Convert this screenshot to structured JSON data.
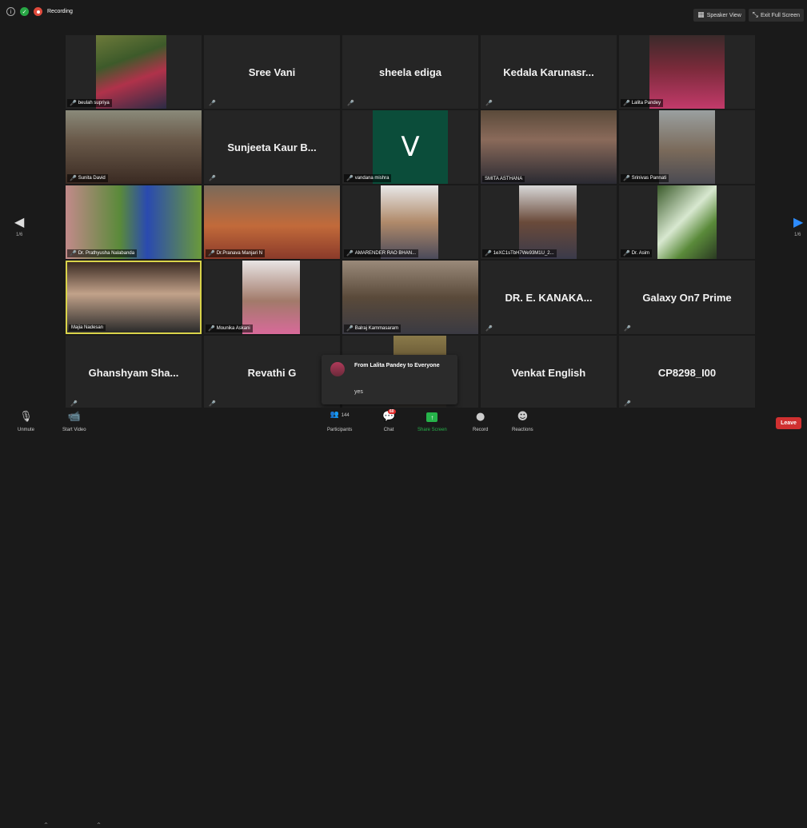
{
  "topbar": {
    "recording_label": "Recording",
    "speaker_view_label": "Speaker View",
    "exit_fullscreen_label": "Exit Full Screen"
  },
  "pagination": {
    "left": "1/6",
    "right": "1/6"
  },
  "tiles": [
    {
      "name": "beulah supriya",
      "display": "",
      "kind": "video"
    },
    {
      "name": "",
      "display": "Sree Vani",
      "kind": "name"
    },
    {
      "name": "",
      "display": "sheela ediga",
      "kind": "name"
    },
    {
      "name": "",
      "display": "Kedala  Karunasr...",
      "kind": "name"
    },
    {
      "name": "Lalita Pandey",
      "display": "",
      "kind": "video"
    },
    {
      "name": "Sunita David",
      "display": "",
      "kind": "video"
    },
    {
      "name": "",
      "display": "Sunjeeta Kaur B...",
      "kind": "name"
    },
    {
      "name": "vandana mishra",
      "display": "V",
      "kind": "avatar"
    },
    {
      "name": "SMITA ASTHANA",
      "display": "",
      "kind": "video"
    },
    {
      "name": "Srinivas Pannati",
      "display": "",
      "kind": "video"
    },
    {
      "name": "Dr. Prathyusha Nalabanda",
      "display": "",
      "kind": "video"
    },
    {
      "name": "Dr.Pranava Manjari N",
      "display": "",
      "kind": "video"
    },
    {
      "name": "AMARENDER RAO BHAN...",
      "display": "",
      "kind": "video"
    },
    {
      "name": "1eXC1sTbH7We93M1U_2...",
      "display": "",
      "kind": "video"
    },
    {
      "name": "Dr. Asim",
      "display": "",
      "kind": "video"
    },
    {
      "name": "Majia Nadesan",
      "display": "",
      "kind": "video"
    },
    {
      "name": "Mounika Askani",
      "display": "",
      "kind": "video"
    },
    {
      "name": "Balraj Kammasaram",
      "display": "",
      "kind": "video"
    },
    {
      "name": "",
      "display": "DR. E. KANAKA...",
      "kind": "name"
    },
    {
      "name": "",
      "display": "Galaxy On7 Prime",
      "kind": "name"
    },
    {
      "name": "",
      "display": "Ghanshyam  Sha...",
      "kind": "name"
    },
    {
      "name": "",
      "display": "Revathi G",
      "kind": "name"
    },
    {
      "name": "",
      "display": "",
      "kind": "video"
    },
    {
      "name": "",
      "display": "Venkat English",
      "kind": "name"
    },
    {
      "name": "",
      "display": "CP8298_I00",
      "kind": "name"
    }
  ],
  "chat": {
    "from": "From Lalita Pandey to Everyone",
    "message": "yes"
  },
  "toolbar": {
    "unmute": "Unmute",
    "start_video": "Start Video",
    "participants": "Participants",
    "participants_count": "144",
    "chat": "Chat",
    "chat_badge": "60",
    "share_screen": "Share Screen",
    "record": "Record",
    "reactions": "Reactions",
    "leave": "Leave"
  },
  "colors": {
    "background": "#1a1a1a",
    "tile": "#252525",
    "active_border": "#d9d34a",
    "muted": "#e04a3c",
    "share_green": "#26b34a",
    "leave_red": "#d03030",
    "avatar_green": "#0b4d3a"
  }
}
